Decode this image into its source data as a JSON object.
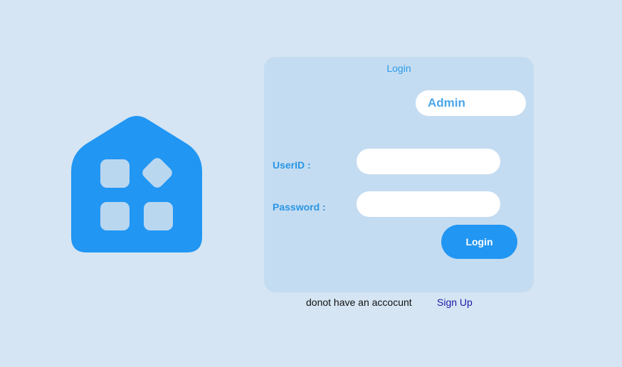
{
  "logo": {
    "icon": "home-apps-icon",
    "color": "#2196f3"
  },
  "login_card": {
    "title": "Login",
    "role_button": "Admin",
    "userid_label": "UserID :",
    "userid_value": "",
    "password_label": "Password :",
    "password_value": "",
    "login_button": "Login"
  },
  "footer": {
    "no_account_text": "donot have an accocunt",
    "signup_link": "Sign Up"
  },
  "colors": {
    "background": "#d5e5f3",
    "card": "#c4dcf1",
    "accent": "#2196f3",
    "link": "#1a1aa8"
  }
}
